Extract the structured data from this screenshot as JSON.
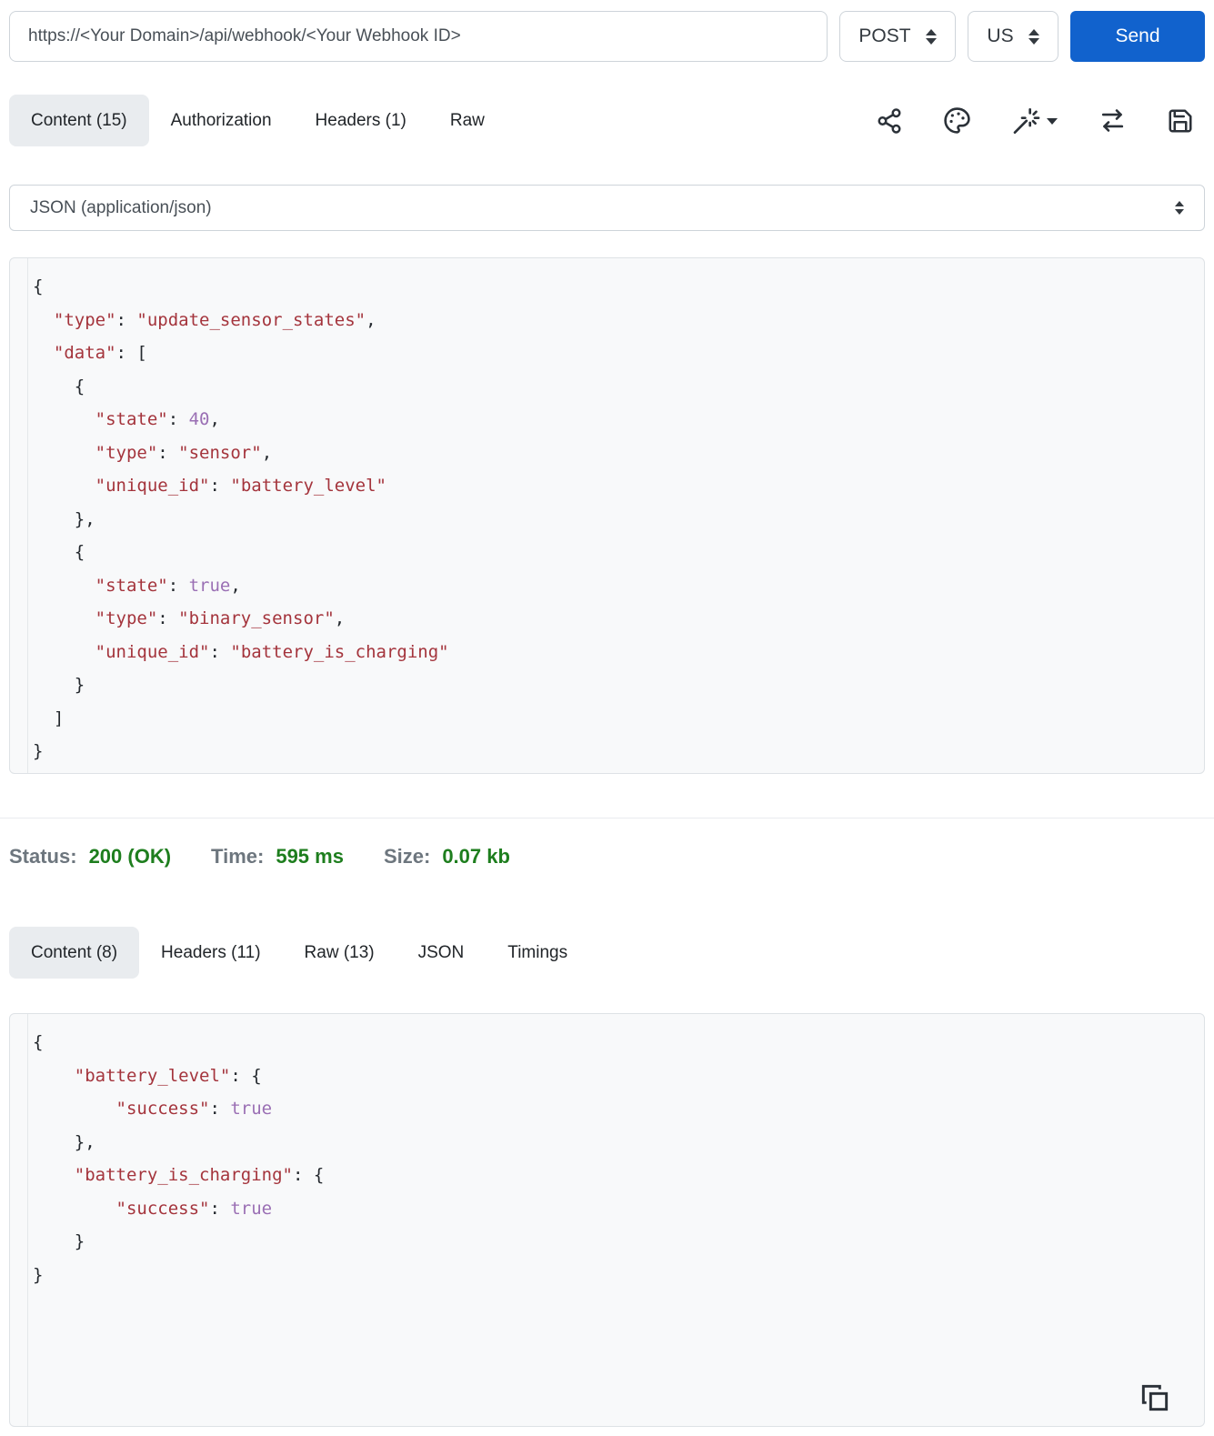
{
  "request_bar": {
    "url": "https://<Your Domain>/api/webhook/<Your Webhook ID>",
    "method": "POST",
    "region": "US",
    "send_label": "Send"
  },
  "request_tabs": [
    {
      "label": "Content (15)",
      "active": true
    },
    {
      "label": "Authorization",
      "active": false
    },
    {
      "label": "Headers (1)",
      "active": false
    },
    {
      "label": "Raw",
      "active": false
    }
  ],
  "toolbar_icons": [
    "share-icon",
    "palette-icon",
    "magic-wand-icon",
    "swap-icon",
    "save-icon"
  ],
  "body_type_select": {
    "value": "JSON (application/json)"
  },
  "request_body_lines": [
    "{",
    "  \"type\": \"update_sensor_states\",",
    "  \"data\": [",
    "    {",
    "      \"state\": 40,",
    "      \"type\": \"sensor\",",
    "      \"unique_id\": \"battery_level\"",
    "    },",
    "    {",
    "      \"state\": true,",
    "      \"type\": \"binary_sensor\",",
    "      \"unique_id\": \"battery_is_charging\"",
    "    }",
    "  ]",
    "}"
  ],
  "response_status": {
    "status_label": "Status:",
    "status_value": "200 (OK)",
    "time_label": "Time:",
    "time_value": "595 ms",
    "size_label": "Size:",
    "size_value": "0.07 kb"
  },
  "response_tabs": [
    {
      "label": "Content (8)",
      "active": true
    },
    {
      "label": "Headers (11)",
      "active": false
    },
    {
      "label": "Raw (13)",
      "active": false
    },
    {
      "label": "JSON",
      "active": false
    },
    {
      "label": "Timings",
      "active": false
    }
  ],
  "response_body_lines": [
    "{",
    "    \"battery_level\": {",
    "        \"success\": true",
    "    },",
    "    \"battery_is_charging\": {",
    "        \"success\": true",
    "    }",
    "}"
  ],
  "response_icons": [
    "copy-icon"
  ],
  "colors": {
    "accent": "#1162cd",
    "success_green": "#1e7e1e",
    "code_string": "#a4343c",
    "code_literal": "#9a6fb4",
    "code_punctuation": "#24292e"
  }
}
